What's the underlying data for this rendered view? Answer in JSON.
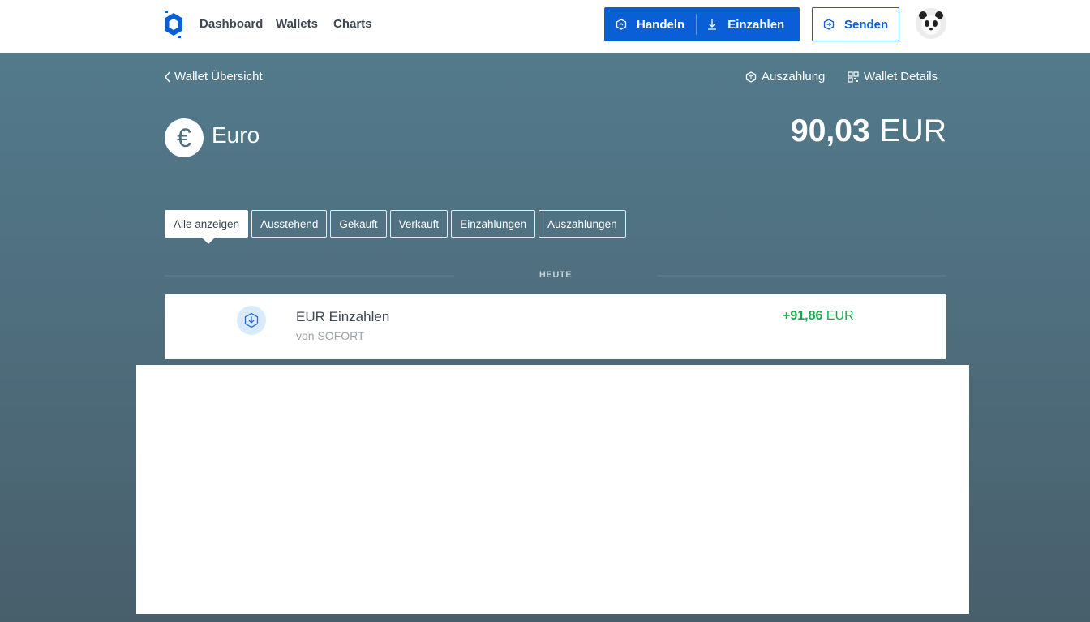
{
  "nav": {
    "links": [
      "Dashboard",
      "Wallets",
      "Charts"
    ],
    "trade_label": "Handeln",
    "deposit_label": "Einzahlen",
    "send_label": "Senden"
  },
  "header": {
    "back_label": "Wallet Übersicht",
    "withdraw_label": "Auszahlung",
    "details_label": "Wallet Details"
  },
  "wallet": {
    "symbol": "€",
    "name": "Euro",
    "balance": "90,03",
    "currency": "EUR"
  },
  "filters": {
    "tabs": [
      "Alle anzeigen",
      "Ausstehend",
      "Gekauft",
      "Verkauft",
      "Einzahlungen",
      "Auszahlungen"
    ],
    "active_index": 0
  },
  "date_group": "HEUTE",
  "transactions": [
    {
      "title": "EUR Einzahlen",
      "subtitle": "von SOFORT",
      "amount": "+91,86",
      "currency": "EUR",
      "icon": "deposit-icon"
    }
  ],
  "colors": {
    "brand": "#0a5fd6",
    "positive": "#1aa84a",
    "hero": "#527a8b"
  }
}
